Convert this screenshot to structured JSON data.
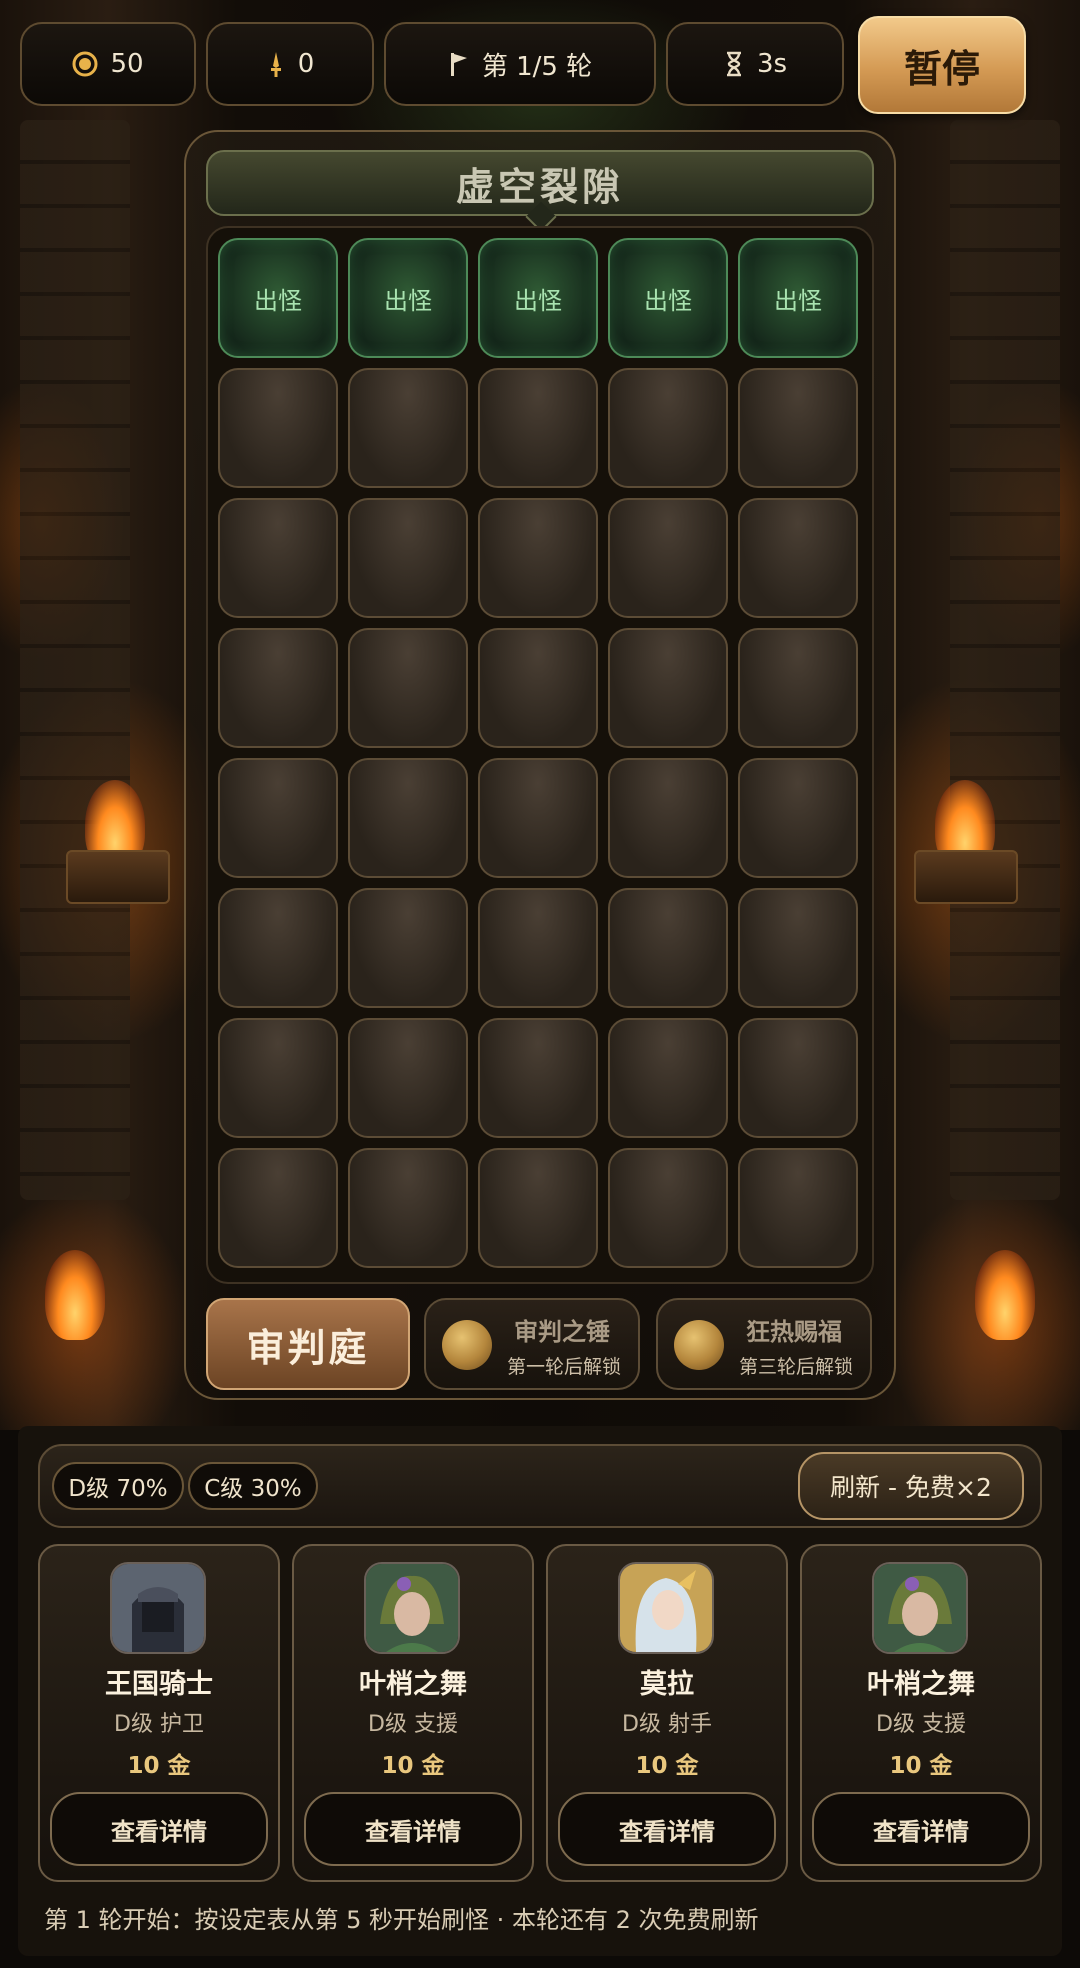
{
  "hud": {
    "gold": "50",
    "attack": "0",
    "round": "第 1/5 轮",
    "timer": "3s",
    "pause_label": "暂停"
  },
  "stage": {
    "title": "虚空裂隙",
    "spawn_label": "出怪",
    "columns": 5,
    "rows": 8
  },
  "skills": {
    "court_label": "审判庭",
    "items": [
      {
        "name": "审判之锤",
        "sub": "第一轮后解锁"
      },
      {
        "name": "狂热赐福",
        "sub": "第三轮后解锁"
      }
    ]
  },
  "shop": {
    "odds": [
      "D级 70%",
      "C级 30%"
    ],
    "refresh_label": "刷新 - 免费×2",
    "cards": [
      {
        "name": "王国骑士",
        "role": "D级 护卫",
        "cost": "10 金",
        "detail": "查看详情",
        "portrait": "knight-portrait-icon"
      },
      {
        "name": "叶梢之舞",
        "role": "D级 支援",
        "cost": "10 金",
        "detail": "查看详情",
        "portrait": "elf-dancer-portrait-icon"
      },
      {
        "name": "莫拉",
        "role": "D级 射手",
        "cost": "10 金",
        "detail": "查看详情",
        "portrait": "archer-portrait-icon"
      },
      {
        "name": "叶梢之舞",
        "role": "D级 支援",
        "cost": "10 金",
        "detail": "查看详情",
        "portrait": "elf-dancer-portrait-icon"
      }
    ]
  },
  "status": "第 1 轮开始：按设定表从第 5 秒开始刷怪 · 本轮还有 2 次免费刷新",
  "colors": {
    "accent_gold": "#d49a54",
    "spawn_green": "#4d8a58",
    "background": "#0d0a07"
  }
}
